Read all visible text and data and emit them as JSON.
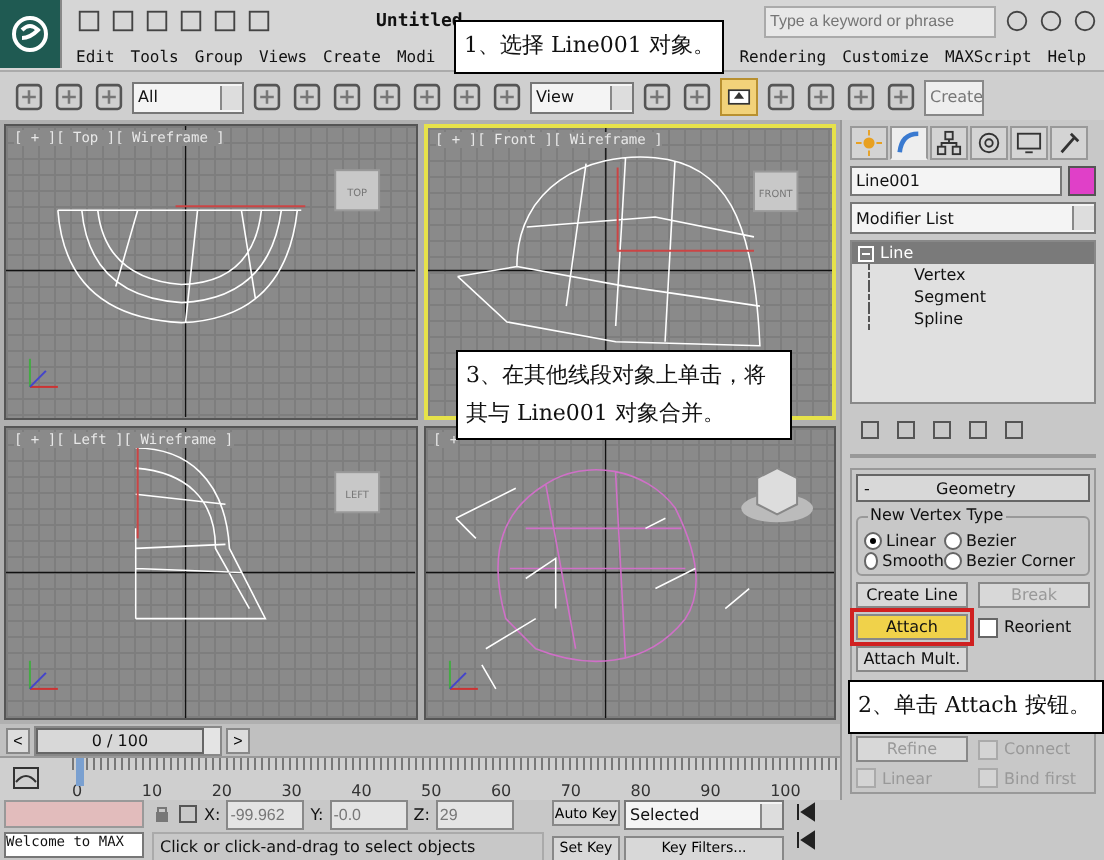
{
  "title_bar": {
    "title": "Untitled",
    "search": {
      "placeholder": "Type a keyword or phrase"
    }
  },
  "menu": [
    "Edit",
    "Tools",
    "Group",
    "Views",
    "Create",
    "Modi",
    "Rendering",
    "Customize",
    "MAXScript",
    "Help"
  ],
  "toolbar": {
    "selection_filter": "All",
    "reference_coordinate": "View",
    "selection_set": "Create"
  },
  "viewports": [
    {
      "kind": "top",
      "label": "[ + ][ Top ][ Wireframe ]",
      "cube_label": "TOP",
      "selected": false
    },
    {
      "kind": "front",
      "label": "[ + ][ Front ][ Wireframe ]",
      "cube_label": "FRONT",
      "selected": true
    },
    {
      "kind": "left",
      "label": "[ + ][ Left ][ Wireframe ]",
      "cube_label": "LEFT",
      "selected": false
    },
    {
      "kind": "perspective",
      "label": "[ +",
      "selected": false
    }
  ],
  "time_slider": {
    "prev": "<",
    "position": "0 / 100",
    "next": ">"
  },
  "track_bar": {
    "ticks": [
      "0",
      "10",
      "20",
      "30",
      "40",
      "50",
      "60",
      "70",
      "80",
      "90",
      "100"
    ]
  },
  "command_panel": {
    "tabs": [
      {
        "kind": "create",
        "selected": false
      },
      {
        "kind": "modify",
        "selected": true
      },
      {
        "kind": "hierarchy",
        "selected": false
      },
      {
        "kind": "motion",
        "selected": false
      },
      {
        "kind": "display",
        "selected": false
      },
      {
        "kind": "utilities",
        "selected": false
      }
    ],
    "object_name": "Line001",
    "modifier_list": "Modifier List",
    "stack": [
      {
        "label": "Line",
        "selected": true,
        "expanded": true,
        "children": [
          {
            "label": "Vertex"
          },
          {
            "label": "Segment"
          },
          {
            "label": "Spline"
          }
        ]
      }
    ],
    "rollout": {
      "toggle": "-",
      "title": "Geometry",
      "vertex_type": {
        "title": "New Vertex Type",
        "options": [
          {
            "label": "Linear",
            "selected": true
          },
          {
            "label": "Bezier",
            "selected": false
          },
          {
            "label": "Smooth",
            "selected": false
          },
          {
            "label": "Bezier Corner",
            "selected": false
          }
        ]
      },
      "controls": [
        {
          "kind": "button",
          "label": "Create Line",
          "disabled": false,
          "active": false,
          "highlighted": false
        },
        {
          "kind": "button",
          "label": "Break",
          "disabled": true,
          "active": false,
          "highlighted": false
        },
        {
          "kind": "button",
          "label": "Attach",
          "disabled": false,
          "active": true,
          "highlighted": true
        },
        {
          "kind": "checkbox",
          "label": "Reorient",
          "disabled": false,
          "checked": false
        },
        {
          "kind": "button",
          "label": "Attach Mult.",
          "disabled": false,
          "active": false,
          "highlighted": false
        },
        {
          "kind": "empty"
        },
        {
          "kind": "button",
          "label": "Refine",
          "disabled": true,
          "active": false,
          "highlighted": false
        },
        {
          "kind": "checkbox",
          "label": "Connect",
          "disabled": true,
          "checked": false
        },
        {
          "kind": "checkbox",
          "label": "Linear",
          "disabled": true,
          "checked": false
        },
        {
          "kind": "checkbox",
          "label": "Bind first",
          "disabled": true,
          "checked": false
        }
      ]
    }
  },
  "status_bar": {
    "welcome": "Welcome to MAX",
    "prompt": "Click or click-and-drag to select objects",
    "x": {
      "label": "X:",
      "value": "-99.962"
    },
    "y": {
      "label": "Y:",
      "value": "-0.0"
    },
    "z": {
      "label": "Z:",
      "value": "29"
    },
    "auto_key": "Auto Key",
    "key_mode": "Selected",
    "set_key": "Set Key",
    "key_filters": "Key Filters..."
  },
  "callouts": [
    {
      "text": "1、选择 Line001 对象。"
    },
    {
      "text": "3、在其他线段对象上单击，将其与 Line001 对象合并。"
    },
    {
      "text": "2、单击 Attach 按钮。"
    }
  ]
}
